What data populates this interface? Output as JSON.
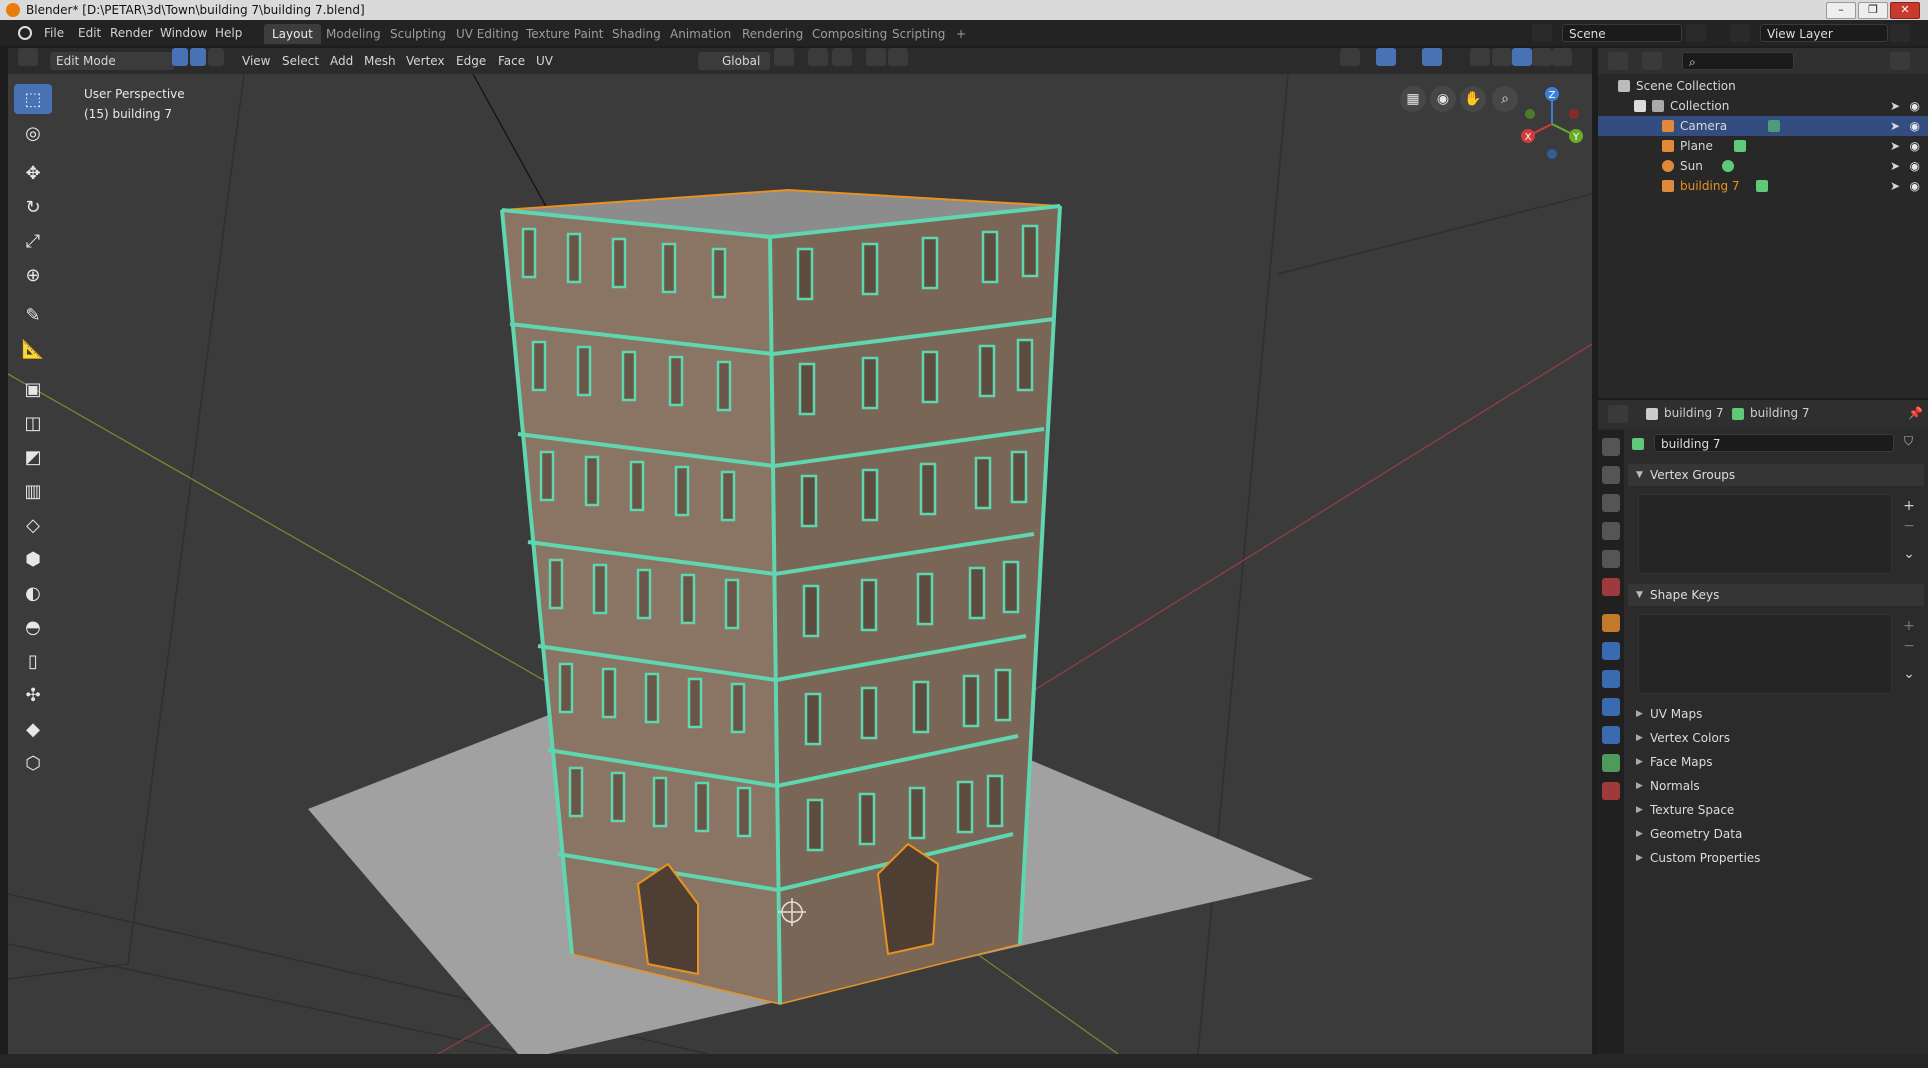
{
  "window": {
    "title": "Blender* [D:\\PETAR\\3d\\Town\\building 7\\building 7.blend]",
    "minimize": "–",
    "maximize": "❐",
    "close": "✕"
  },
  "menu": [
    "File",
    "Edit",
    "Render",
    "Window",
    "Help"
  ],
  "workspaces": [
    "Layout",
    "Modeling",
    "Sculpting",
    "UV Editing",
    "Texture Paint",
    "Shading",
    "Animation",
    "Rendering",
    "Compositing",
    "Scripting",
    "+"
  ],
  "active_workspace": "Layout",
  "scene": {
    "name": "Scene",
    "view_layer": "View Layer"
  },
  "viewport_header": {
    "mode": "Edit Mode",
    "menus": [
      "View",
      "Select",
      "Add",
      "Mesh",
      "Vertex",
      "Edge",
      "Face",
      "UV"
    ],
    "orientation": "Global"
  },
  "viewport": {
    "perspective_label": "User Perspective",
    "object_label": "(15) building 7",
    "gizmo": {
      "x": "X",
      "y": "Y",
      "z": "Z"
    }
  },
  "outliner": {
    "root": "Scene Collection",
    "collection": "Collection",
    "items": [
      {
        "name": "Camera",
        "icon": "camera-icon",
        "selected": true
      },
      {
        "name": "Plane",
        "icon": "mesh-icon",
        "selected": false
      },
      {
        "name": "Sun",
        "icon": "light-icon",
        "selected": false
      },
      {
        "name": "building 7",
        "icon": "mesh-icon",
        "selected": false,
        "active": true
      }
    ]
  },
  "properties": {
    "object_name": "building 7",
    "mesh_name": "building 7",
    "data_field": "building 7",
    "panels": {
      "vertex_groups": "Vertex Groups",
      "shape_keys": "Shape Keys"
    },
    "collapsed": [
      "UV Maps",
      "Vertex Colors",
      "Face Maps",
      "Normals",
      "Texture Space",
      "Geometry Data",
      "Custom Properties"
    ]
  },
  "colors": {
    "accent": "#4772b3",
    "edit_wire": "#5fd5b0",
    "edit_edge": "#e8921f",
    "active_object": "#e8921f"
  }
}
